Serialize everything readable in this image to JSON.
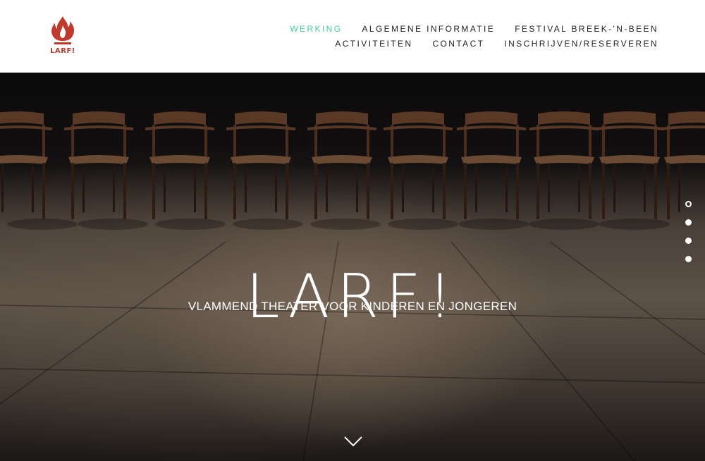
{
  "brand": {
    "logo_icon": "flame-icon",
    "logo_text": "LARF!",
    "logo_color": "#c0392b"
  },
  "nav": {
    "active_color": "#45d39b",
    "row1": [
      {
        "label": "WERKING",
        "active": true
      },
      {
        "label": "ALGEMENE INFORMATIE",
        "active": false
      },
      {
        "label": "FESTIVAL BREEK-'N-BEEN",
        "active": false
      }
    ],
    "row2": [
      {
        "label": "ACTIVITEITEN",
        "active": false
      },
      {
        "label": "CONTACT",
        "active": false
      },
      {
        "label": "INSCHRIJVEN/RESERVEREN",
        "active": false
      }
    ]
  },
  "hero": {
    "title": "LARF!",
    "subtitle": "VLAMMEND THEATER VOOR KINDEREN EN JONGEREN",
    "background_image": "row of wooden chairs on a dark theatre stage",
    "slide_dots": [
      {
        "active": true
      },
      {
        "active": false
      },
      {
        "active": false
      },
      {
        "active": false
      }
    ],
    "scroll_icon": "chevron-down-icon"
  }
}
